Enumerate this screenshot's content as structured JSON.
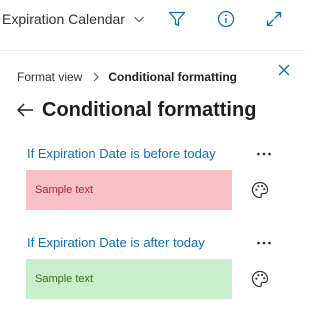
{
  "toolbar": {
    "view_name": "Expiration Calendar",
    "icons": [
      "chevron-down-icon",
      "filter-icon",
      "info-icon",
      "expand-icon"
    ]
  },
  "panel": {
    "breadcrumb": {
      "parent": "Format view",
      "current": "Conditional formatting"
    },
    "title": "Conditional formatting",
    "rules": [
      {
        "condition": "If Expiration Date is before today",
        "sample_text": "Sample text",
        "background": "#f9c0c5",
        "text_color": "#a4262c"
      },
      {
        "condition": "If Expiration Date is after today",
        "sample_text": "Sample text",
        "background": "#c9efca",
        "text_color": "#3f6b1f"
      }
    ]
  },
  "colors": {
    "accent": "#0f6cbd",
    "text": "#201f1e"
  }
}
